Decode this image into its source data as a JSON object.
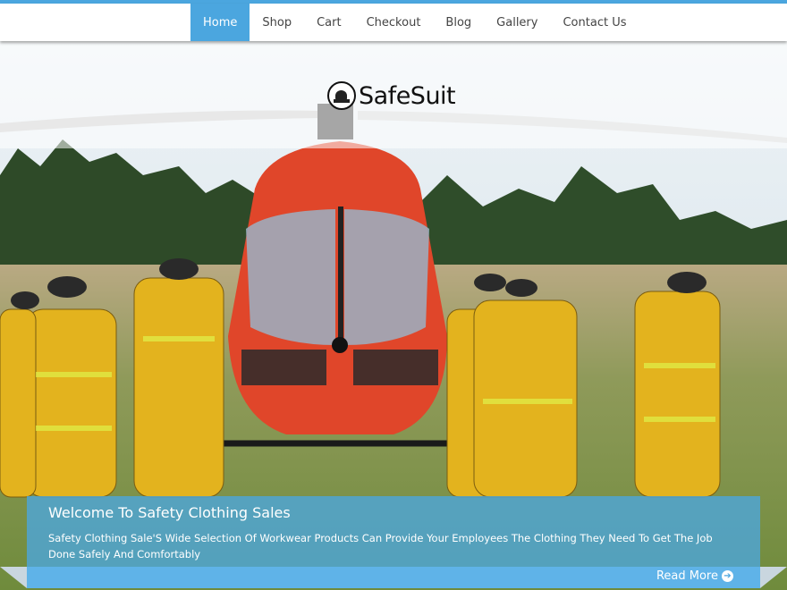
{
  "nav": {
    "items": [
      {
        "label": "Home",
        "active": true
      },
      {
        "label": "Shop"
      },
      {
        "label": "Cart"
      },
      {
        "label": "Checkout"
      },
      {
        "label": "Blog"
      },
      {
        "label": "Gallery"
      },
      {
        "label": "Contact Us"
      }
    ]
  },
  "brand": {
    "name": "SafeSuit",
    "logo_icon": "helmet-icon"
  },
  "hero": {
    "image": "helicopter-firefighters-photo",
    "title": "Welcome To Safety Clothing Sales",
    "description": "Safety Clothing Sale'S Wide Selection Of Workwear Products Can Provide Your Employees The Clothing They Need To Get The Job Done Safely And Comfortably",
    "read_more": "Read More"
  },
  "colors": {
    "accent": "#4ba6df",
    "helicopter": "#e0462a",
    "suit": "#e3b31e"
  }
}
